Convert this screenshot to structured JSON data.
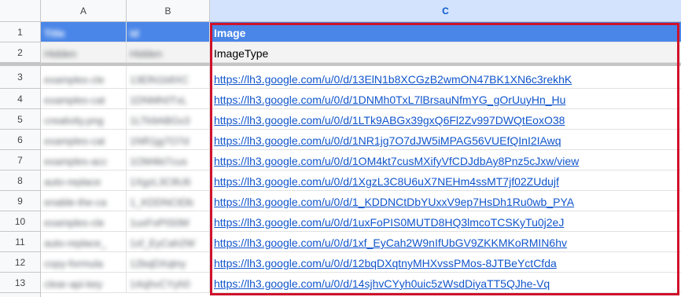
{
  "columns": [
    "A",
    "B",
    "C"
  ],
  "rows": [
    {
      "num": "1",
      "a": "Title",
      "b": "Id",
      "c": "Image"
    },
    {
      "num": "2",
      "a": "Hidden",
      "b": "Hidden",
      "c": "ImageType"
    },
    {
      "num": "3",
      "a": "examples-cle",
      "b": "13ElN1b8XC",
      "c": "https://lh3.google.com/u/0/d/13ElN1b8XCGzB2wmON47BK1XN6c3rekhK"
    },
    {
      "num": "4",
      "a": "examples-cat",
      "b": "1DNMh0TxL",
      "c": "https://lh3.google.com/u/0/d/1DNMh0TxL7lBrsauNfmYG_gOrUuyHn_Hu"
    },
    {
      "num": "5",
      "a": "creativity.png",
      "b": "1LTk9ABGx3",
      "c": "https://lh3.google.com/u/0/d/1LTk9ABGx39gxQ6Fl2Zv997DWQtEoxO38"
    },
    {
      "num": "6",
      "a": "examples-cat",
      "b": "1NR1jg7O7d",
      "c": "https://lh3.google.com/u/0/d/1NR1jg7O7dJW5iMPAG56VUEfQInI2IAwq"
    },
    {
      "num": "7",
      "a": "examples-acc",
      "b": "1OM4kt7cus",
      "c": "https://lh3.google.com/u/0/d/1OM4kt7cusMXifyVfCDJdbAy8Pnz5cJxw/view"
    },
    {
      "num": "8",
      "a": "auto-replace",
      "b": "1XgzL3C8U6",
      "c": "https://lh3.google.com/u/0/d/1XgzL3C8U6uX7NEHm4ssMT7jf02ZUdujf"
    },
    {
      "num": "9",
      "a": "enable-the-ca",
      "b": "1_KDDNCtDb",
      "c": "https://lh3.google.com/u/0/d/1_KDDNCtDbYUxxV9ep7HsDh1Ru0wb_PYA"
    },
    {
      "num": "10",
      "a": "examples-cle",
      "b": "1uxFoPIS0M",
      "c": "https://lh3.google.com/u/0/d/1uxFoPIS0MUTD8HQ3lmcoTCSKyTu0j2eJ"
    },
    {
      "num": "11",
      "a": "auto-replace_",
      "b": "1xf_EyCah2W",
      "c": "https://lh3.google.com/u/0/d/1xf_EyCah2W9nIfUbGV9ZKKMKoRMIN6hv"
    },
    {
      "num": "12",
      "a": "copy-formula",
      "b": "12bqDXqtny",
      "c": "https://lh3.google.com/u/0/d/12bqDXqtnyMHXvssPMos-8JTBeYctCfda"
    },
    {
      "num": "13",
      "a": "clear-api-key",
      "b": "14sjhvCYyh0",
      "c": "https://lh3.google.com/u/0/d/14sjhvCYyh0uic5zWsdDiyaTT5QJhe-Vq"
    }
  ]
}
